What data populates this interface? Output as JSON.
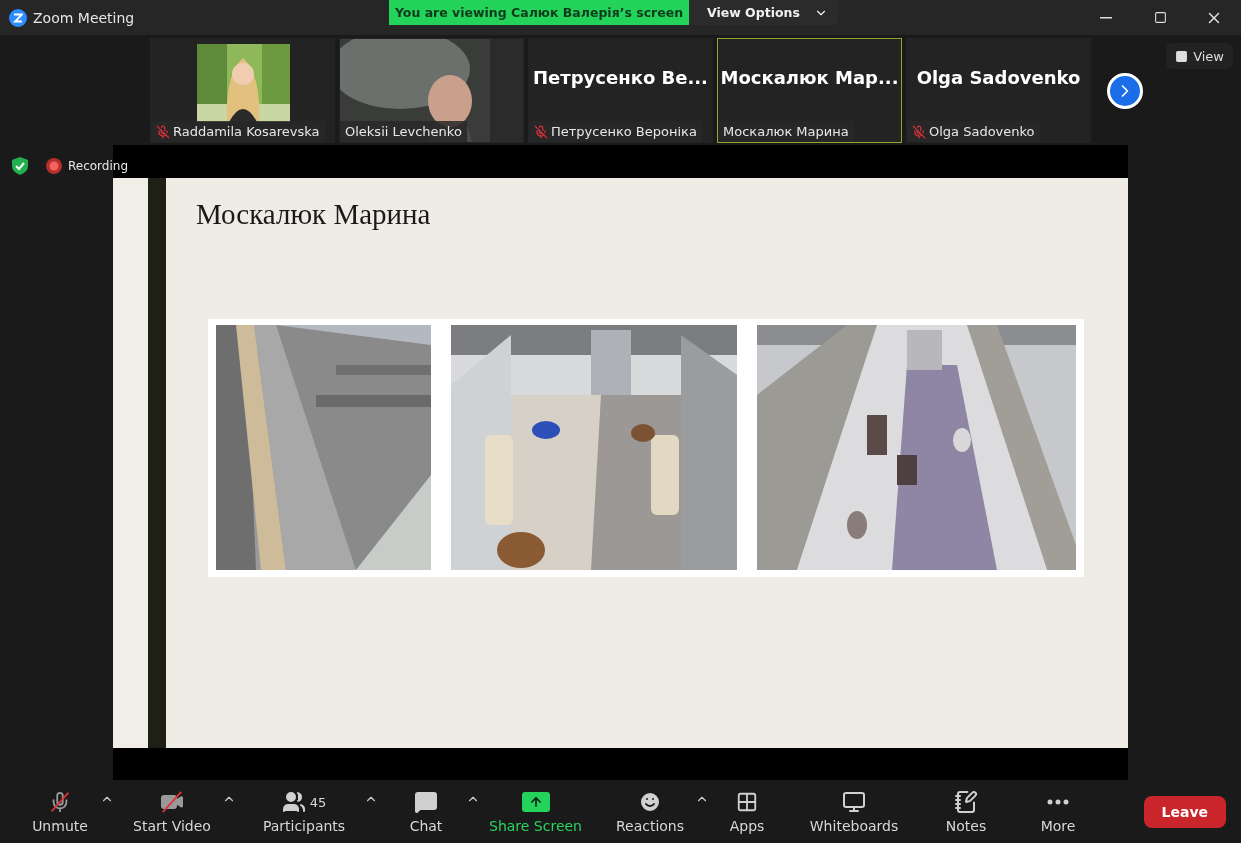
{
  "window": {
    "title": "Zoom Meeting"
  },
  "share_banner": {
    "text": "You are viewing Салюк Валерія’s screen",
    "options_label": "View Options"
  },
  "view_button": {
    "label": "View"
  },
  "tiles": [
    {
      "name": "Raddamila Kosarevska",
      "muted": true,
      "active_speaker": false
    },
    {
      "kind": "video",
      "name": "Oleksii Levchenko",
      "muted": false,
      "active_speaker": false
    },
    {
      "kind": "name",
      "display_name": "Петрусенко  Ве...",
      "name": "Петрусенко Вероніка",
      "muted": true,
      "active_speaker": false
    },
    {
      "kind": "name",
      "display_name": "Москалюк  Мар...",
      "name": "Москалюк Марина",
      "muted": false,
      "active_speaker": true
    },
    {
      "kind": "name",
      "display_name": "Olga Sadovenko",
      "name": "Olga Sadovenko",
      "muted": true,
      "active_speaker": false
    }
  ],
  "status": {
    "encrypted": true,
    "recording_label": "Recording"
  },
  "slide": {
    "title": "Москалюк Марина"
  },
  "toolbar": [
    {
      "kind": "mic",
      "label": "Unmute",
      "off": true,
      "menu": true,
      "highlighted": false
    },
    {
      "kind": "camera",
      "label": "Start Video",
      "off": true,
      "menu": true,
      "highlighted": false
    },
    {
      "kind": "participants",
      "label": "Participants",
      "count": "45",
      "off": false,
      "menu": true,
      "highlighted": false
    },
    {
      "kind": "chat",
      "label": "Chat",
      "off": false,
      "menu": true,
      "highlighted": false
    },
    {
      "kind": "share",
      "label": "Share Screen",
      "off": false,
      "menu": false,
      "highlighted": true
    },
    {
      "kind": "reactions",
      "label": "Reactions",
      "off": false,
      "menu": true,
      "highlighted": false
    },
    {
      "kind": "apps",
      "label": "Apps",
      "off": false,
      "menu": false,
      "highlighted": false
    },
    {
      "kind": "whiteboards",
      "label": "Whiteboards",
      "off": false,
      "menu": false,
      "highlighted": false
    },
    {
      "kind": "notes",
      "label": "Notes",
      "off": false,
      "menu": false,
      "highlighted": false
    },
    {
      "kind": "more",
      "label": "More",
      "off": false,
      "menu": false,
      "highlighted": false
    }
  ],
  "leave_button": {
    "label": "Leave"
  }
}
